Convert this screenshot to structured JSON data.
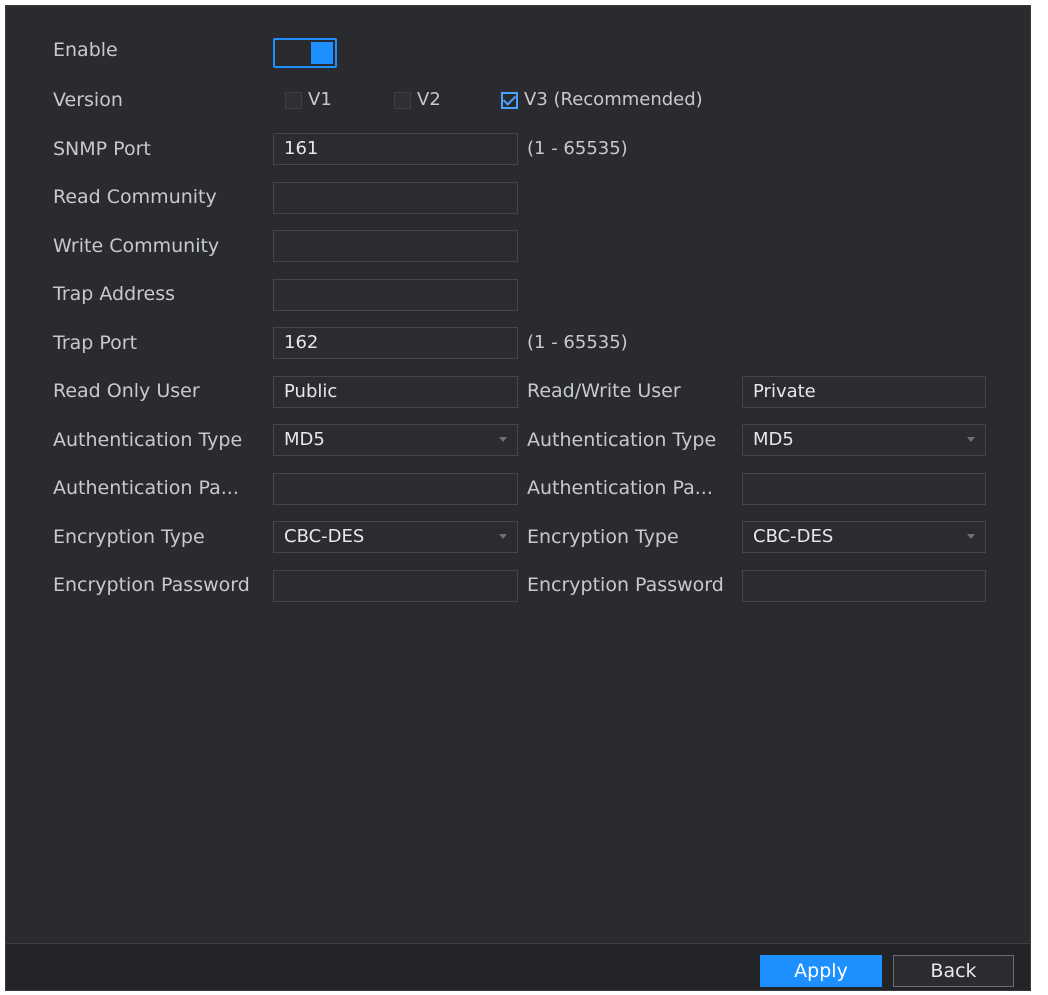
{
  "form": {
    "enable": {
      "label": "Enable",
      "value": true
    },
    "version": {
      "label": "Version",
      "options": [
        {
          "label": "V1",
          "checked": false
        },
        {
          "label": "V2",
          "checked": false
        },
        {
          "label": "V3 (Recommended)",
          "checked": true
        }
      ]
    },
    "snmp_port": {
      "label": "SNMP Port",
      "value": "161",
      "range": "(1 - 65535)"
    },
    "read_community": {
      "label": "Read Community",
      "value": ""
    },
    "write_community": {
      "label": "Write Community",
      "value": ""
    },
    "trap_address": {
      "label": "Trap Address",
      "value": ""
    },
    "trap_port": {
      "label": "Trap Port",
      "value": "162",
      "range": "(1 - 65535)"
    },
    "read_only": {
      "user_label": "Read Only User",
      "user_value": "Public",
      "auth_type_label": "Authentication Type",
      "auth_type_value": "MD5",
      "auth_password_label": "Authentication Pa...",
      "auth_password_value": "",
      "enc_type_label": "Encryption Type",
      "enc_type_value": "CBC-DES",
      "enc_password_label": "Encryption Password",
      "enc_password_value": ""
    },
    "read_write": {
      "user_label": "Read/Write User",
      "user_value": "Private",
      "auth_type_label": "Authentication Type",
      "auth_type_value": "MD5",
      "auth_password_label": "Authentication Pa...",
      "auth_password_value": "",
      "enc_type_label": "Encryption Type",
      "enc_type_value": "CBC-DES",
      "enc_password_label": "Encryption Password",
      "enc_password_value": ""
    }
  },
  "footer": {
    "apply_label": "Apply",
    "back_label": "Back"
  },
  "colors": {
    "background": "#2a2b2f",
    "accent": "#1e8fff",
    "text": "#c7c9cd"
  },
  "icons": {
    "select_arrow": "chevron-down-icon",
    "checkbox_check": "check-icon"
  }
}
